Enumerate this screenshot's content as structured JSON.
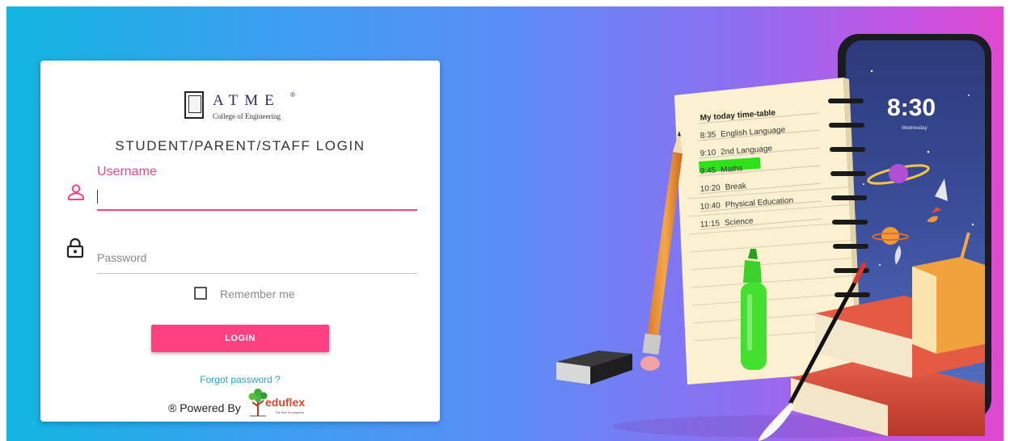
{
  "college": {
    "name": "ATME",
    "registered_mark": "®",
    "subtitle": "College of Engineering"
  },
  "login": {
    "title": "STUDENT/PARENT/STAFF LOGIN",
    "username_label": "Username",
    "username_value": "",
    "password_placeholder": "Password",
    "remember_label": "Remember me",
    "remember_checked": false,
    "button_label": "LOGIN",
    "forgot_label": "Forgot password ?"
  },
  "footer": {
    "powered_by": "® Powered By",
    "brand": "eduflex",
    "tagline": "The free of progress"
  },
  "icons": {
    "username": "person-outline-icon",
    "password": "lock-icon",
    "eduflex": "tree-icon"
  },
  "illustration": {
    "timetable_title": "My today time-table",
    "timetable": [
      {
        "time": "8:35",
        "subject": "English Language"
      },
      {
        "time": "9:10",
        "subject": "2nd Language"
      },
      {
        "time": "9:45",
        "subject": "Maths",
        "highlighted": true
      },
      {
        "time": "10:20",
        "subject": "Break"
      },
      {
        "time": "10:40",
        "subject": "Physical Education"
      },
      {
        "time": "11:15",
        "subject": "Science"
      }
    ],
    "phone_time": "8:30",
    "phone_day": "Wednesday"
  },
  "colors": {
    "accent": "#ff4081",
    "link": "#25a4d6",
    "highlight": "#2ee21a",
    "gradient": [
      "#12b6e0",
      "#5a8ef6",
      "#e048cf"
    ]
  }
}
